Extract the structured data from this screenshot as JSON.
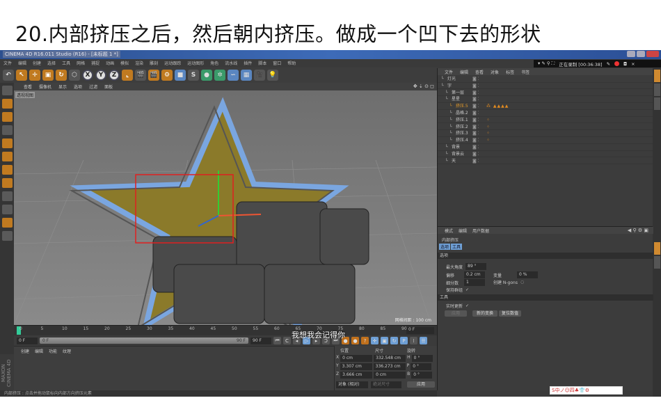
{
  "heading": "20.内部挤压之后，然后朝内挤压。做成一个凹下去的形状",
  "window": {
    "title": "CINEMA 4D R16.011 Studio (R16) - [未标题 1 *]"
  },
  "recording": {
    "status": "正在录制 [00:36:38]"
  },
  "menu": [
    "文件",
    "编辑",
    "创建",
    "选择",
    "工具",
    "网格",
    "捕捉",
    "动画",
    "模拟",
    "渲染",
    "雕刻",
    "运动跟踪",
    "运动图形",
    "角色",
    "流水线",
    "插件",
    "脚本",
    "窗口",
    "帮助"
  ],
  "toolbar": {
    "axis_x": "X",
    "axis_y": "Y",
    "axis_z": "Z"
  },
  "viewport": {
    "menu": [
      "查看",
      "摄像机",
      "显示",
      "选项",
      "过滤",
      "面板"
    ],
    "label": "透视视图",
    "grid_spacing": "网格间距 : 100 cm",
    "icons": "✥ ⇣ ⊙ ◻"
  },
  "timeline": {
    "ticks": [
      "0",
      "5",
      "10",
      "15",
      "20",
      "25",
      "30",
      "35",
      "40",
      "45",
      "50",
      "55",
      "60",
      "65",
      "70",
      "75",
      "80",
      "85",
      "90"
    ],
    "current": "0 F"
  },
  "controls": {
    "start": "0 F",
    "scrub_start": "0 F",
    "scrub_end": "90 F",
    "end": "90 F"
  },
  "material_manager": {
    "menu": [
      "创建",
      "编辑",
      "功能",
      "纹理"
    ]
  },
  "coordinates": {
    "headers": [
      "位置",
      "尺寸",
      "旋转"
    ],
    "rows": [
      {
        "axis": "X",
        "pos": "0 cm",
        "size": "332.548 cm",
        "rot_axis": "H",
        "rot": "0 °"
      },
      {
        "axis": "Y",
        "pos": "3.307 cm",
        "size": "336.273 cm",
        "rot_axis": "P",
        "rot": "0 °"
      },
      {
        "axis": "Z",
        "pos": "3.666 cm",
        "size": "0 cm",
        "rot_axis": "B",
        "rot": "0 °"
      }
    ],
    "mode": "对象 (相对)",
    "size_mode": "绝对尺寸",
    "apply": "应用"
  },
  "brand": "MAXON CINEMA 4D",
  "status": "内部挤压 : 点击并拖动鼠标向内部方向挤压元素",
  "subtitle": "我想我会记得你",
  "object_manager": {
    "menu": [
      "文件",
      "编辑",
      "查看",
      "对象",
      "标签",
      "书签"
    ],
    "objects": [
      {
        "name": "灯光",
        "indent": 0
      },
      {
        "name": "字",
        "indent": 0
      },
      {
        "name": "第一层",
        "indent": 1
      },
      {
        "name": "星星",
        "indent": 1
      },
      {
        "name": "挤压.5",
        "indent": 2,
        "selected": true,
        "tags": "⁂ ▲▲▲▲"
      },
      {
        "name": "晶格.2",
        "indent": 2
      },
      {
        "name": "挤压.1",
        "indent": 2,
        "tags": "⁘"
      },
      {
        "name": "挤压.2",
        "indent": 2,
        "tags": "⁘"
      },
      {
        "name": "挤压.3",
        "indent": 2,
        "tags": "⁘"
      },
      {
        "name": "挤压.4",
        "indent": 2,
        "tags": "⁘"
      },
      {
        "name": "背景",
        "indent": 1
      },
      {
        "name": "背景云",
        "indent": 1
      },
      {
        "name": "天",
        "indent": 1
      }
    ]
  },
  "attributes": {
    "menu": [
      "模式",
      "编辑",
      "用户数据"
    ],
    "title": "内部挤压",
    "tabs": [
      "选项",
      "工具"
    ],
    "section_options": "选项",
    "max_angle_label": "最大角度",
    "max_angle": "89 °",
    "offset_label": "偏移",
    "offset": "0.2 cm",
    "variance_label": "变量",
    "variance": "0 %",
    "subdiv_label": "细分数",
    "subdiv": "1",
    "ngons_label": "创建 N-gons",
    "keep_groups_label": "保持群组",
    "check": "✓",
    "section_tool": "工具",
    "realtime_label": "实时更新",
    "buttons": [
      "应用",
      "新的变换",
      "复位数值"
    ]
  },
  "watermark": "S中ノ☺四♣👕⚙"
}
